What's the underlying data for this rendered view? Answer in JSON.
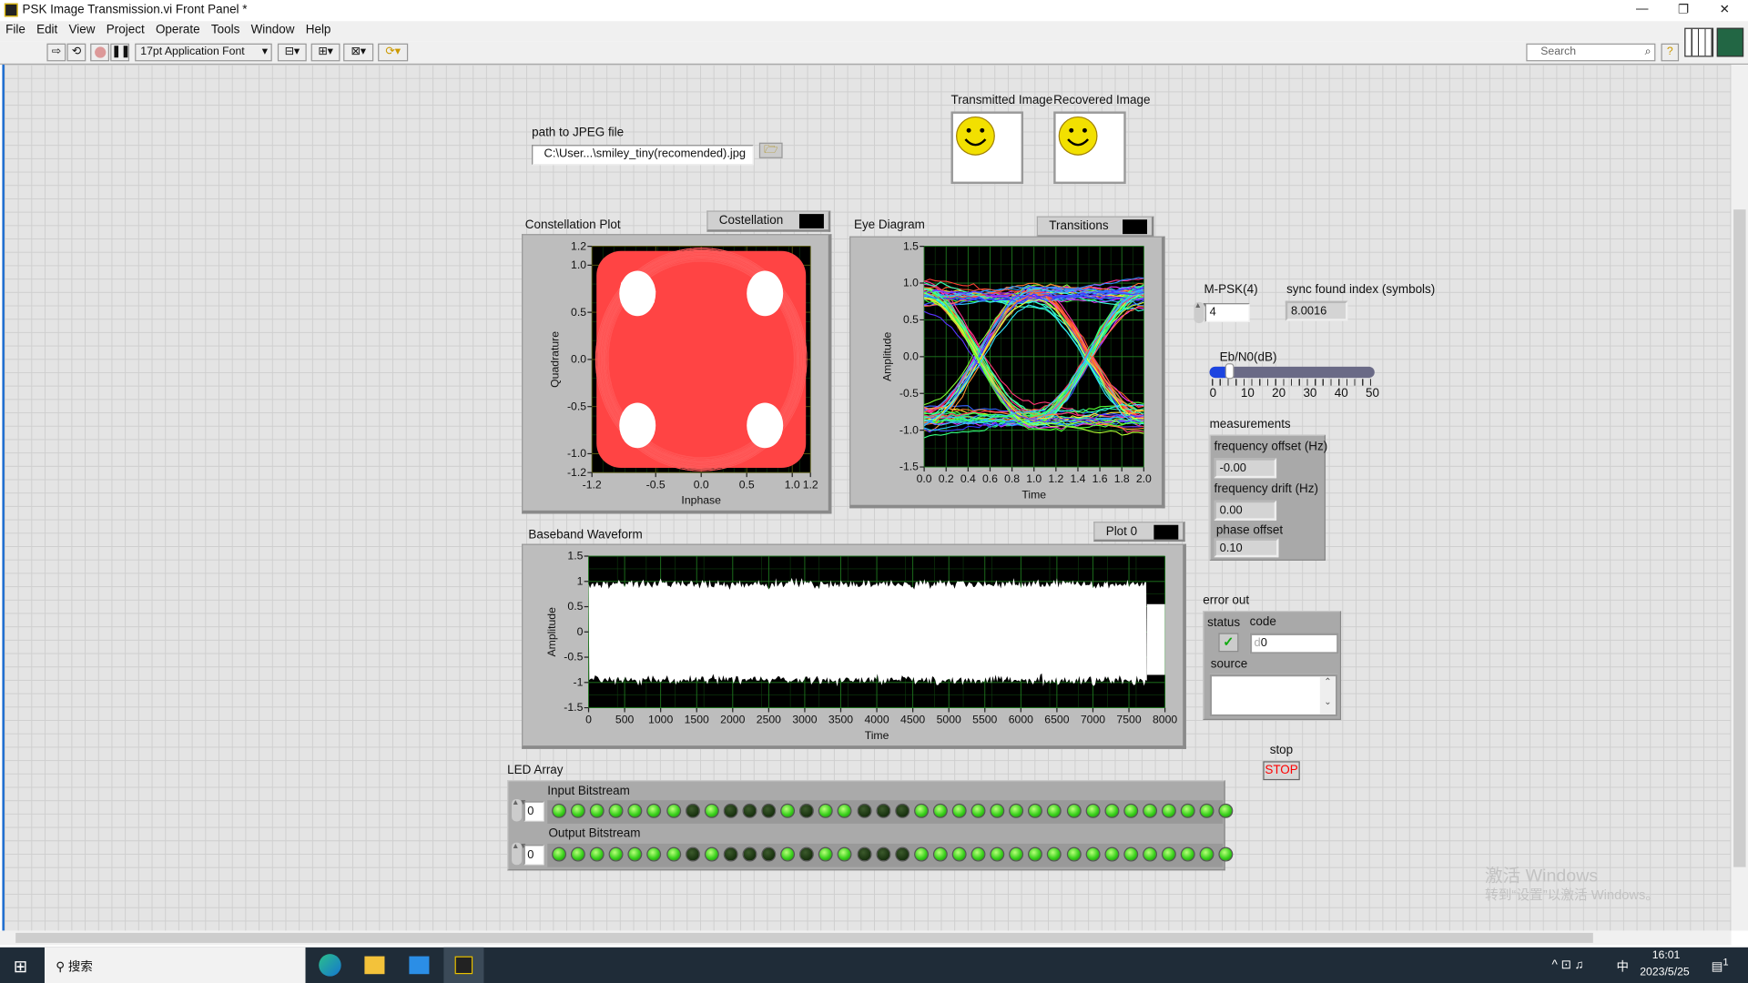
{
  "window": {
    "title": "PSK Image Transmission.vi Front Panel *",
    "minimize": "—",
    "restore": "❐",
    "close": "✕"
  },
  "menu": [
    "File",
    "Edit",
    "View",
    "Project",
    "Operate",
    "Tools",
    "Window",
    "Help"
  ],
  "toolbar": {
    "font": "17pt Application Font",
    "search_placeholder": "Search"
  },
  "path": {
    "label": "path to JPEG file",
    "value": "C:\\User...\\smiley_tiny(recomended).jpg"
  },
  "images": {
    "transmitted_label": "Transmitted Image",
    "recovered_label": "Recovered Image"
  },
  "mpsk": {
    "label": "M-PSK(4)",
    "value": "4"
  },
  "sync": {
    "label": "sync found index (symbols)",
    "value": "8.0016"
  },
  "ebn0": {
    "label": "Eb/N0(dB)",
    "value": 5,
    "min": 0,
    "max": 50,
    "ticks": [
      "0",
      "10",
      "20",
      "30",
      "40",
      "50"
    ]
  },
  "measurements": {
    "label": "measurements",
    "freq_offset_label": "frequency offset (Hz)",
    "freq_offset": "-0.00",
    "freq_drift_label": "frequency drift (Hz)",
    "freq_drift": "0.00",
    "phase_offset_label": "phase offset",
    "phase_offset": "0.10"
  },
  "error_out": {
    "label": "error out",
    "status_label": "status",
    "code_label": "code",
    "code_radix": "d",
    "code": "0",
    "source_label": "source",
    "source": ""
  },
  "stop": {
    "label": "stop",
    "button": "STOP"
  },
  "led_array": {
    "label": "LED Array",
    "input_label": "Input Bitstream",
    "output_label": "Output Bitstream",
    "input_index": "0",
    "output_index": "0",
    "input": [
      1,
      1,
      1,
      1,
      1,
      1,
      1,
      0,
      1,
      0,
      0,
      0,
      1,
      0,
      1,
      1,
      0,
      0,
      0,
      1,
      1,
      1,
      1,
      1,
      1,
      1,
      1,
      1,
      1,
      1,
      1,
      1,
      1,
      1,
      1,
      1
    ],
    "output": [
      1,
      1,
      1,
      1,
      1,
      1,
      1,
      0,
      1,
      0,
      0,
      0,
      1,
      0,
      1,
      1,
      0,
      0,
      0,
      1,
      1,
      1,
      1,
      1,
      1,
      1,
      1,
      1,
      1,
      1,
      1,
      1,
      1,
      1,
      1,
      1
    ]
  },
  "watermark": {
    "line1": "激活 Windows",
    "line2": "转到“设置”以激活 Windows。"
  },
  "taskbar": {
    "search": "搜索",
    "time": "16:01",
    "date": "2023/5/25",
    "ime": "中",
    "notifications": "1"
  },
  "colors": {
    "plot_bg": "#000000",
    "grid": "#1f7a1f",
    "constellation_trace": "#ff4444",
    "symbols": "#ffffff",
    "accent": "#1a6bd0"
  },
  "chart_data": [
    {
      "type": "scatter",
      "title": "Constellation Plot",
      "legend": "Costellation",
      "xlabel": "Inphase",
      "ylabel": "Quadrature",
      "xlim": [
        -1.2,
        1.2
      ],
      "ylim": [
        -1.2,
        1.2
      ],
      "xticks": [
        "-1.2",
        "-0.5",
        "0.0",
        "0.5",
        "1.0",
        "1.2"
      ],
      "yticks": [
        "1.2",
        "1.0",
        "0.5",
        "0.0",
        "-0.5",
        "-1.0",
        "-1.2"
      ],
      "symbol_centers": [
        [
          -0.7,
          0.7
        ],
        [
          0.7,
          0.7
        ],
        [
          -0.7,
          -0.7
        ],
        [
          0.7,
          -0.7
        ]
      ],
      "grid": true
    },
    {
      "type": "line",
      "title": "Eye Diagram",
      "legend": "Transitions",
      "xlabel": "Time",
      "ylabel": "Amplitude",
      "xlim": [
        0,
        2
      ],
      "ylim": [
        -1.5,
        1.5
      ],
      "xticks": [
        "0.0",
        "0.2",
        "0.4",
        "0.6",
        "0.8",
        "1.0",
        "1.2",
        "1.4",
        "1.6",
        "1.8",
        "2.0"
      ],
      "yticks": [
        "1.5",
        "1.0",
        "0.5",
        "0.0",
        "-0.5",
        "-1.0",
        "-1.5"
      ],
      "levels": [
        -0.9,
        0.9
      ],
      "grid": true
    },
    {
      "type": "line",
      "title": "Baseband Waveform",
      "legend": "Plot 0",
      "xlabel": "Time",
      "ylabel": "Amplitude",
      "xlim": [
        0,
        8000
      ],
      "ylim": [
        -1.5,
        1.5
      ],
      "xticks": [
        "0",
        "500",
        "1000",
        "1500",
        "2000",
        "2500",
        "3000",
        "3500",
        "4000",
        "4500",
        "5000",
        "5500",
        "6000",
        "6500",
        "7000",
        "7500",
        "8000"
      ],
      "yticks": [
        "1.5",
        "1",
        "0.5",
        "0",
        "-0.5",
        "-1",
        "-1.5"
      ],
      "envelope_upper": 1.0,
      "envelope_lower": -1.0,
      "signal_end": 7750,
      "grid": true
    }
  ]
}
